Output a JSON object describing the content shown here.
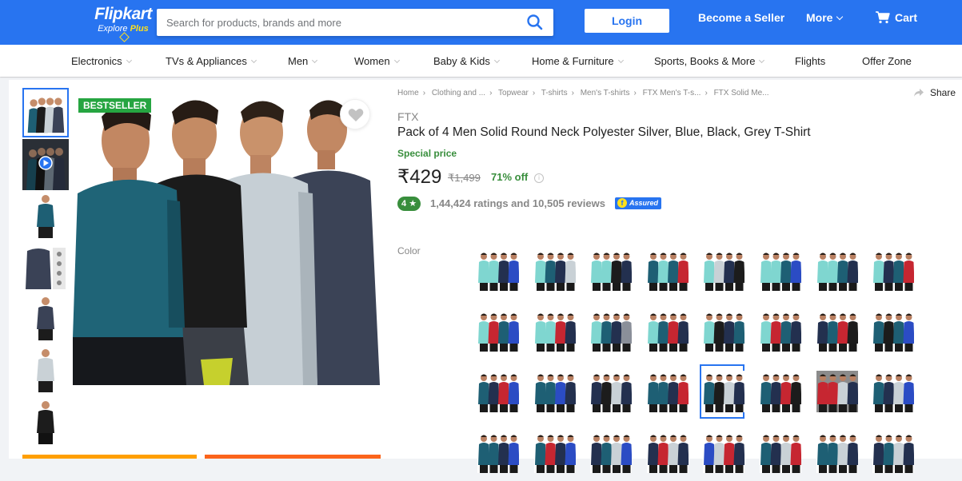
{
  "header": {
    "logo_text": "Flipkart",
    "logo_sub_prefix": "Explore",
    "logo_sub_plus": "Plus",
    "search_placeholder": "Search for products, brands and more",
    "login_label": "Login",
    "seller_label": "Become a Seller",
    "more_label": "More",
    "cart_label": "Cart"
  },
  "nav": {
    "items": [
      {
        "label": "Electronics",
        "has_menu": true
      },
      {
        "label": "TVs & Appliances",
        "has_menu": true
      },
      {
        "label": "Men",
        "has_menu": true
      },
      {
        "label": "Women",
        "has_menu": true
      },
      {
        "label": "Baby & Kids",
        "has_menu": true
      },
      {
        "label": "Home & Furniture",
        "has_menu": true
      },
      {
        "label": "Sports, Books & More",
        "has_menu": true
      },
      {
        "label": "Flights",
        "has_menu": false
      },
      {
        "label": "Offer Zone",
        "has_menu": false
      }
    ]
  },
  "gallery": {
    "bestseller_label": "BESTSELLER",
    "thumbnails": [
      "4-pack",
      "video",
      "teal-tee",
      "detail",
      "grey-navy-tee",
      "silver-tee",
      "black-tee"
    ]
  },
  "breadcrumb": [
    "Home",
    "Clothing and ...",
    "Topwear",
    "T-shirts",
    "Men's T-shirts",
    "FTX Men's T-s...",
    "FTX Solid Me..."
  ],
  "share_label": "Share",
  "product": {
    "brand": "FTX",
    "title": "Pack of 4 Men Solid Round Neck Polyester Silver, Blue, Black, Grey T-Shirt",
    "special_label": "Special price",
    "price": "₹429",
    "mrp": "₹1,499",
    "discount": "71% off",
    "rating": "4",
    "rating_summary": "1,44,424 ratings and 10,505 reviews",
    "assured_label": "Assured"
  },
  "color_label": "Color",
  "colors": {
    "teal": "#1e5f74",
    "mint": "#7fd6d0",
    "black": "#1c1c1c",
    "navy": "#23304f",
    "grey": "#8a8f99",
    "silver": "#c9d1d6",
    "red": "#c62631",
    "blue": "#2b4cc4",
    "cream": "#e8e0c8"
  },
  "swatches": [
    [
      "mint",
      "mint",
      "navy",
      "blue"
    ],
    [
      "mint",
      "teal",
      "navy",
      "silver"
    ],
    [
      "mint",
      "mint",
      "black",
      "navy"
    ],
    [
      "teal",
      "mint",
      "teal",
      "red"
    ],
    [
      "mint",
      "silver",
      "navy",
      "black"
    ],
    [
      "mint",
      "mint",
      "teal",
      "blue"
    ],
    [
      "mint",
      "mint",
      "teal",
      "navy"
    ],
    [
      "mint",
      "navy",
      "teal",
      "red"
    ],
    [
      "mint",
      "red",
      "teal",
      "blue"
    ],
    [
      "mint",
      "mint",
      "red",
      "navy"
    ],
    [
      "mint",
      "teal",
      "navy",
      "grey"
    ],
    [
      "mint",
      "teal",
      "red",
      "navy"
    ],
    [
      "mint",
      "black",
      "navy",
      "teal"
    ],
    [
      "mint",
      "red",
      "teal",
      "navy"
    ],
    [
      "navy",
      "teal",
      "red",
      "black"
    ],
    [
      "teal",
      "black",
      "teal",
      "blue"
    ],
    [
      "teal",
      "navy",
      "red",
      "blue"
    ],
    [
      "teal",
      "teal",
      "blue",
      "navy"
    ],
    [
      "navy",
      "black",
      "silver",
      "navy"
    ],
    [
      "teal",
      "teal",
      "navy",
      "red"
    ],
    [
      "teal",
      "black",
      "silver",
      "navy"
    ],
    [
      "teal",
      "navy",
      "red",
      "black"
    ],
    [
      "red",
      "red",
      "silver",
      "navy"
    ],
    [
      "teal",
      "navy",
      "silver",
      "blue"
    ],
    [
      "teal",
      "teal",
      "navy",
      "blue"
    ],
    [
      "teal",
      "red",
      "navy",
      "blue"
    ],
    [
      "navy",
      "teal",
      "silver",
      "blue"
    ],
    [
      "navy",
      "red",
      "silver",
      "navy"
    ],
    [
      "blue",
      "silver",
      "red",
      "navy"
    ],
    [
      "teal",
      "navy",
      "silver",
      "red"
    ],
    [
      "teal",
      "teal",
      "silver",
      "navy"
    ],
    [
      "navy",
      "teal",
      "silver",
      "navy"
    ]
  ],
  "selected_swatch": 20
}
